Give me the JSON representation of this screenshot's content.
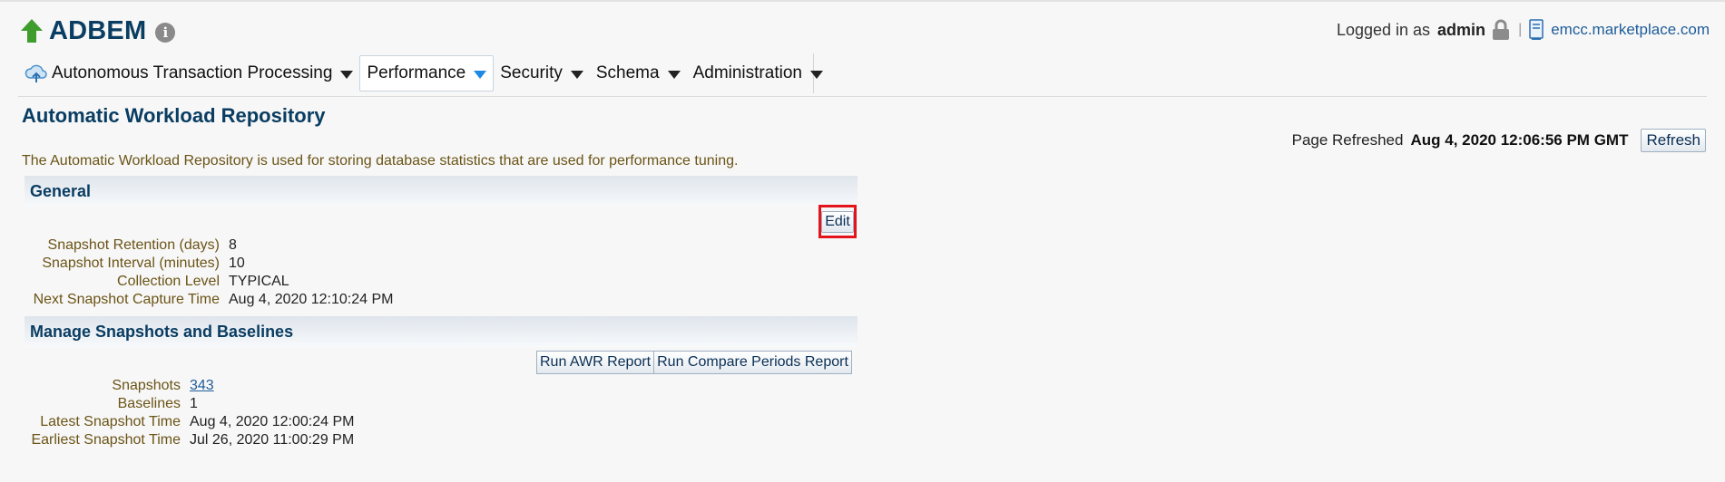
{
  "header": {
    "db_name": "ADBEM",
    "logged_in_label": "Logged in as",
    "username": "admin",
    "host": "emcc.marketplace.com"
  },
  "nav": {
    "items": [
      {
        "label": "Autonomous Transaction Processing",
        "icon": "cloud-icon"
      },
      {
        "label": "Performance",
        "active": true
      },
      {
        "label": "Security"
      },
      {
        "label": "Schema"
      },
      {
        "label": "Administration"
      }
    ]
  },
  "page": {
    "title": "Automatic Workload Repository",
    "refreshed_label": "Page Refreshed",
    "refreshed_value": "Aug 4, 2020 12:06:56 PM GMT",
    "refresh_button": "Refresh",
    "description": "The Automatic Workload Repository is used for storing database statistics that are used for performance tuning."
  },
  "general": {
    "title": "General",
    "edit_button": "Edit",
    "rows": [
      {
        "label": "Snapshot Retention (days)",
        "value": "8"
      },
      {
        "label": "Snapshot Interval (minutes)",
        "value": "10"
      },
      {
        "label": "Collection Level",
        "value": "TYPICAL"
      },
      {
        "label": "Next Snapshot Capture Time",
        "value": "Aug 4, 2020 12:10:24 PM"
      }
    ]
  },
  "snapshots": {
    "title": "Manage Snapshots and Baselines",
    "run_awr_button": "Run AWR Report",
    "run_compare_button": "Run Compare Periods Report",
    "rows": [
      {
        "label": "Snapshots",
        "value": "343",
        "link": true
      },
      {
        "label": "Baselines",
        "value": "1"
      },
      {
        "label": "Latest Snapshot Time",
        "value": "Aug 4, 2020 12:00:24 PM"
      },
      {
        "label": "Earliest Snapshot Time",
        "value": "Jul 26, 2020 11:00:29 PM"
      }
    ]
  },
  "colors": {
    "title_blue": "#0a3d62",
    "label_olive": "#6b5416",
    "link_blue": "#1f5c99",
    "highlight_red": "#e3141b",
    "arrow_green": "#3f9d2e"
  }
}
